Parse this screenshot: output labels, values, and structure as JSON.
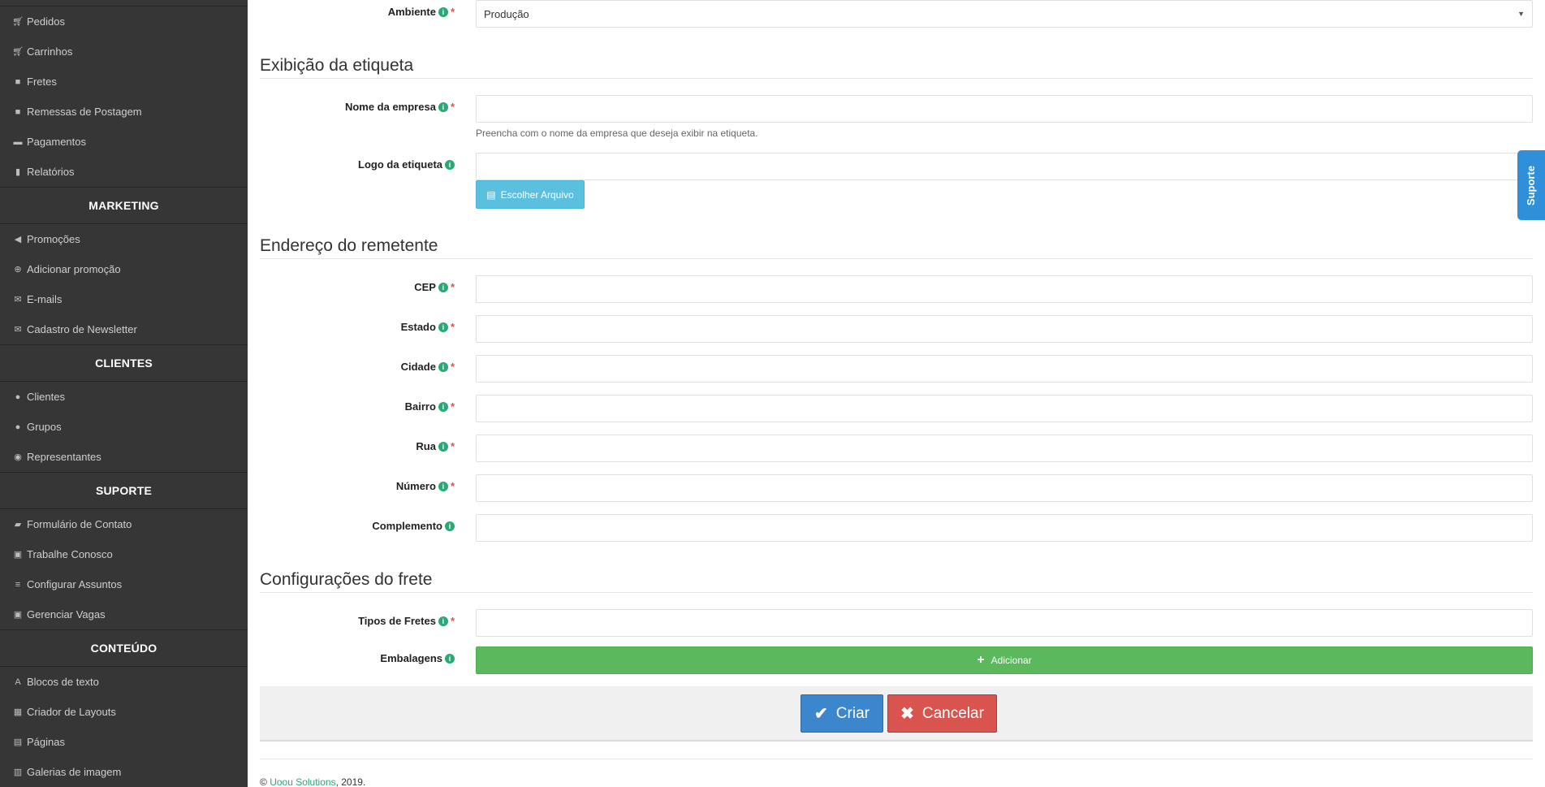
{
  "sidebar": {
    "group1": [
      {
        "label": "Pedidos",
        "icon": "cart-icon"
      },
      {
        "label": "Carrinhos",
        "icon": "cart-icon"
      },
      {
        "label": "Fretes",
        "icon": "truck-icon"
      },
      {
        "label": "Remessas de Postagem",
        "icon": "truck-icon"
      },
      {
        "label": "Pagamentos",
        "icon": "credit-card-icon"
      },
      {
        "label": "Relatórios",
        "icon": "bar-chart-icon"
      }
    ],
    "marketing": {
      "title": "MARKETING",
      "items": [
        {
          "label": "Promoções",
          "icon": "bullhorn-icon"
        },
        {
          "label": "Adicionar promoção",
          "icon": "plus-circle-icon"
        },
        {
          "label": "E-mails",
          "icon": "envelope-icon"
        },
        {
          "label": "Cadastro de Newsletter",
          "icon": "envelope-icon"
        }
      ]
    },
    "clientes": {
      "title": "CLIENTES",
      "items": [
        {
          "label": "Clientes",
          "icon": "user-icon"
        },
        {
          "label": "Grupos",
          "icon": "users-icon"
        },
        {
          "label": "Representantes",
          "icon": "user-circle-icon"
        }
      ]
    },
    "suporte": {
      "title": "SUPORTE",
      "items": [
        {
          "label": "Formulário de Contato",
          "icon": "comment-icon"
        },
        {
          "label": "Trabalhe Conosco",
          "icon": "briefcase-icon"
        },
        {
          "label": "Configurar Assuntos",
          "icon": "list-icon"
        },
        {
          "label": "Gerenciar Vagas",
          "icon": "briefcase-icon"
        }
      ]
    },
    "conteudo": {
      "title": "CONTEÚDO",
      "items": [
        {
          "label": "Blocos de texto",
          "icon": "font-icon"
        },
        {
          "label": "Criador de Layouts",
          "icon": "layout-icon"
        },
        {
          "label": "Páginas",
          "icon": "file-icon"
        },
        {
          "label": "Galerias de imagem",
          "icon": "film-icon"
        }
      ]
    }
  },
  "form": {
    "ambiente": {
      "label": "Ambiente",
      "value": "Produção"
    },
    "section_etiqueta": "Exibição da etiqueta",
    "nome_empresa": {
      "label": "Nome da empresa",
      "hint": "Preencha com o nome da empresa que deseja exibir na etiqueta."
    },
    "logo": {
      "label": "Logo da etiqueta",
      "button": "Escolher Arquivo"
    },
    "section_remetente": "Endereço do remetente",
    "cep": {
      "label": "CEP"
    },
    "estado": {
      "label": "Estado"
    },
    "cidade": {
      "label": "Cidade"
    },
    "bairro": {
      "label": "Bairro"
    },
    "rua": {
      "label": "Rua"
    },
    "numero": {
      "label": "Número"
    },
    "complemento": {
      "label": "Complemento"
    },
    "section_frete": "Configurações do frete",
    "tipos_fretes": {
      "label": "Tipos de Fretes"
    },
    "embalagens": {
      "label": "Embalagens",
      "button": "Adicionar"
    }
  },
  "actions": {
    "criar": "Criar",
    "cancelar": "Cancelar"
  },
  "footer": {
    "copyright": "©",
    "company": "Uoou Solutions",
    "year": ", 2019."
  },
  "suporte_tab": "Suporte"
}
